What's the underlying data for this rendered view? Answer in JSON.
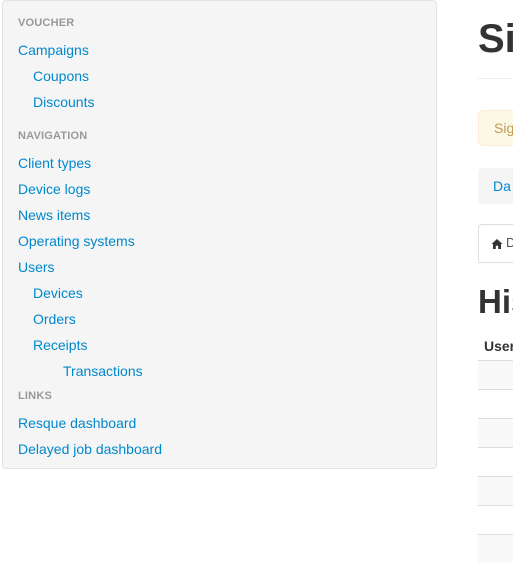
{
  "sidebar": {
    "sections": [
      {
        "header": "Voucher",
        "items": [
          {
            "label": "Campaigns",
            "level": 0
          },
          {
            "label": "Coupons",
            "level": 1
          },
          {
            "label": "Discounts",
            "level": 1
          }
        ]
      },
      {
        "header": "Navigation",
        "items": [
          {
            "label": "Client types",
            "level": 0
          },
          {
            "label": "Device logs",
            "level": 0
          },
          {
            "label": "News items",
            "level": 0
          },
          {
            "label": "Operating systems",
            "level": 0
          },
          {
            "label": "Users",
            "level": 0
          },
          {
            "label": "Devices",
            "level": 1
          },
          {
            "label": "Orders",
            "level": 1
          },
          {
            "label": "Receipts",
            "level": 1
          },
          {
            "label": "Transactions",
            "level": 2
          }
        ]
      },
      {
        "header": "Links",
        "items": [
          {
            "label": "Resque dashboard",
            "level": 0
          },
          {
            "label": "Delayed job dashboard",
            "level": 0
          }
        ]
      }
    ]
  },
  "main": {
    "title": "Si",
    "alert": "Sig",
    "breadcrumb": "Da",
    "tab_label": "D",
    "section_title": "His",
    "table_header": "User"
  },
  "colors": {
    "link": "#0088cc",
    "sidebar_bg": "#f5f5f5",
    "alert_bg": "#fcf8e3",
    "alert_text": "#c09853"
  }
}
